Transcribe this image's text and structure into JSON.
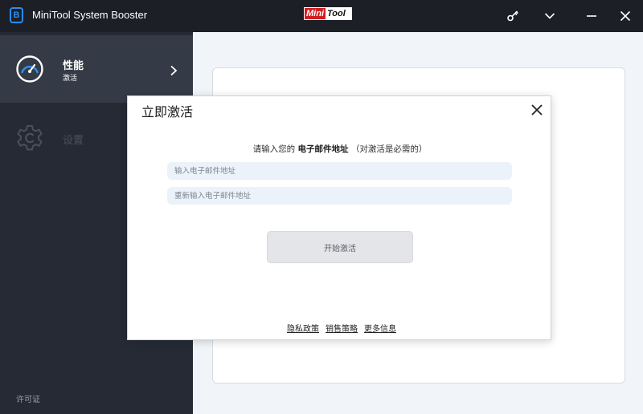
{
  "window": {
    "title": "MiniTool System Booster",
    "app_icon_letter": "B",
    "brand_mini": "Mini",
    "brand_tool": "Tool",
    "controls": [
      "key-icon",
      "chevron-down-icon",
      "minimize-icon",
      "close-icon"
    ]
  },
  "sidebar": {
    "items": [
      {
        "label": "性能",
        "sublabel": "激活",
        "icon": "speedometer-icon",
        "active": true
      },
      {
        "label": "设置",
        "icon": "gear-icon",
        "active": false
      }
    ],
    "footer_link": "许可证"
  },
  "dialog": {
    "title": "立即激活",
    "prompt_pre": "请输入您的",
    "prompt_bold": "电子邮件地址",
    "prompt_post": "（对激活是必需的）",
    "email_placeholder": "输入电子邮件地址",
    "reenter_placeholder": "重新输入电子邮件地址",
    "activate_button": "开始激活",
    "links": [
      "隐私政策",
      "销售策略",
      "更多信息"
    ]
  },
  "colors": {
    "titlebar_bg": "#1c1f26",
    "sidebar_bg": "#262a34",
    "sidebar_active_bg": "#343a46",
    "accent": "#2f8cf0",
    "input_bg": "#ebf2fa"
  }
}
